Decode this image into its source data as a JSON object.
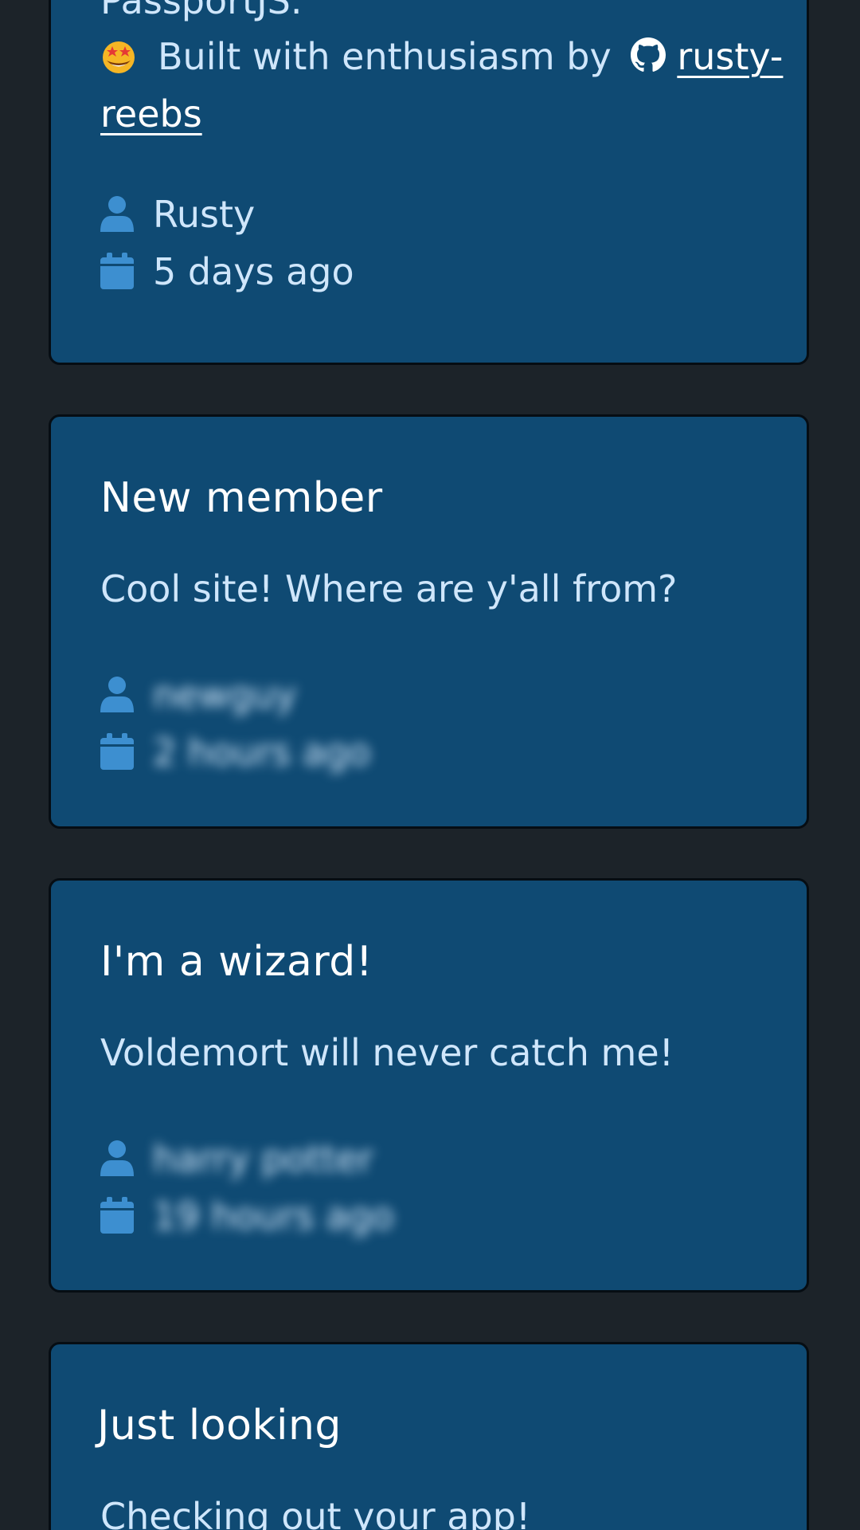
{
  "posts": [
    {
      "body_partial": "PassportJS.",
      "credit_text": "Built with enthusiasm by",
      "credit_link": "rusty-reebs",
      "author": "Rusty",
      "date": "5 days ago"
    },
    {
      "title": "New member",
      "body": "Cool site! Where are y'all from?",
      "author": "newguy",
      "date": "2 hours ago"
    },
    {
      "title": "I'm a wizard!",
      "body": "Voldemort will never catch me!",
      "author": "harry potter",
      "date": "19 hours ago"
    },
    {
      "title": "Just looking",
      "body": "Checking out your app!"
    }
  ],
  "icons": {
    "author": "user-icon",
    "date": "calendar-icon",
    "credit": "github-icon",
    "emoji": "star-struck-emoji-icon"
  },
  "colors": {
    "page_background": "#1c2329",
    "card_background": "#0f4a73",
    "icon": "#3d8fd0",
    "text": "#cfe6fb"
  }
}
